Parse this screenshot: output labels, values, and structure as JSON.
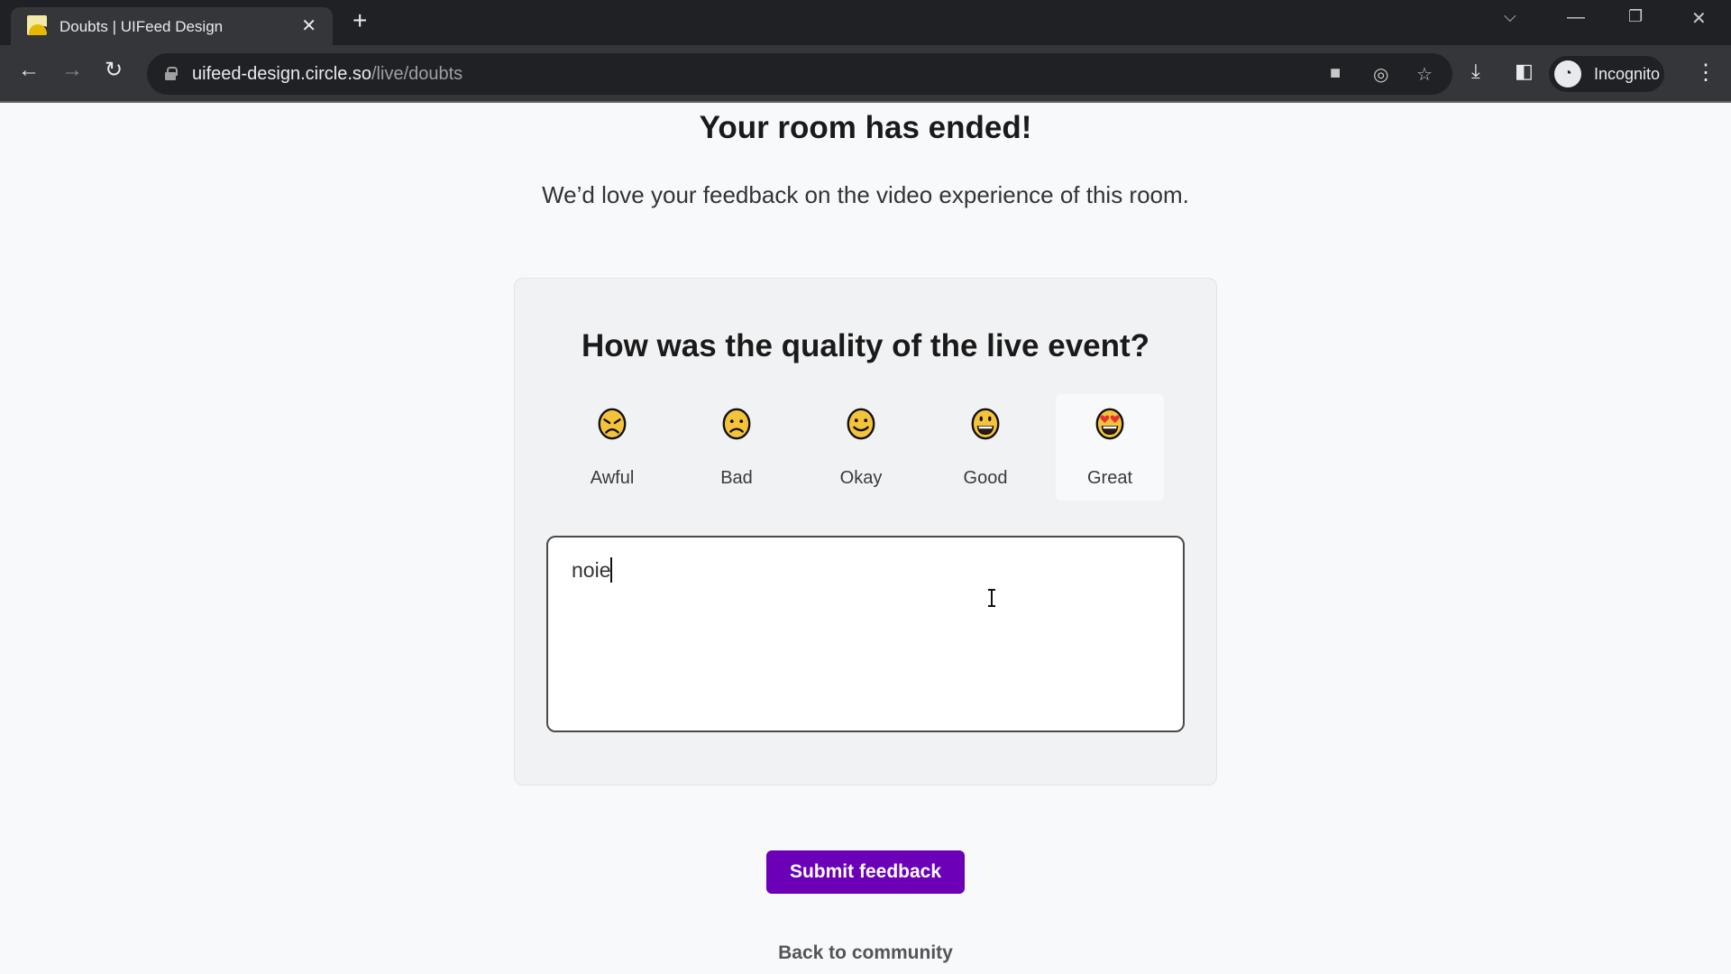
{
  "browser": {
    "tab_title": "Doubts | UIFeed Design",
    "url_domain": "uifeed-design.circle.so",
    "url_path": "/live/doubts",
    "profile_label": "Incognito"
  },
  "page": {
    "title": "Your room has ended!",
    "subtitle": "We’d love your feedback on the video experience of this room."
  },
  "feedback": {
    "question": "How was the quality of the live event?",
    "ratings": [
      {
        "label": "Awful",
        "icon": "angry-face-icon"
      },
      {
        "label": "Bad",
        "icon": "frowning-face-icon"
      },
      {
        "label": "Okay",
        "icon": "slightly-smiling-face-icon"
      },
      {
        "label": "Good",
        "icon": "grinning-face-icon"
      },
      {
        "label": "Great",
        "icon": "heart-eyes-face-icon"
      }
    ],
    "selected": "Great",
    "comment_value": "noie",
    "submit_label": "Submit feedback",
    "back_label": "Back to community"
  },
  "colors": {
    "accent": "#6b00b8"
  }
}
